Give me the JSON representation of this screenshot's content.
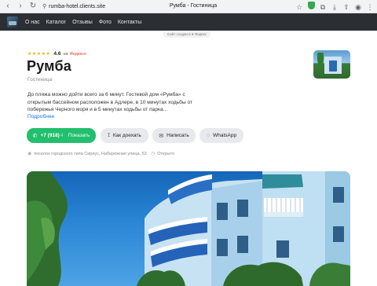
{
  "browser": {
    "url": "rumba-hotel.clients.site",
    "title": "Румба - Гостиница"
  },
  "nav": {
    "items": [
      "О нас",
      "Каталог",
      "Отзывы",
      "Фото",
      "Контакты"
    ]
  },
  "made_with": "Сайт создан в ● Яндекс",
  "business": {
    "rating": "4.6",
    "rating_on": "на",
    "rating_source": "Яндексе",
    "stars": "★★★★★",
    "name": "Румба",
    "category": "Гостиница",
    "description": "До пляжа можно дойти всего за 6 минут. Гостевой дом «Румба» с открытым бассейном расположен в Адлере, в 10 минутах ходьбы от побережья Черного моря и в 5 минутах ходьбы от парка...",
    "more_link": "Подробнее"
  },
  "actions": {
    "phone_prefix": "+7 (918)",
    "phone_hidden": "4 ",
    "show_label": "Показать",
    "route_label": "Как доехать",
    "write_label": "Написать",
    "whatsapp_label": "WhatsApp"
  },
  "info": {
    "address": "поселок городского типа Сириус, Набережная улица, 53",
    "status": "Открыто"
  },
  "colors": {
    "call_button": "#22bf6e",
    "nav_background": "#2b2f33",
    "link": "#1a73e8",
    "stars": "#f7b500"
  }
}
